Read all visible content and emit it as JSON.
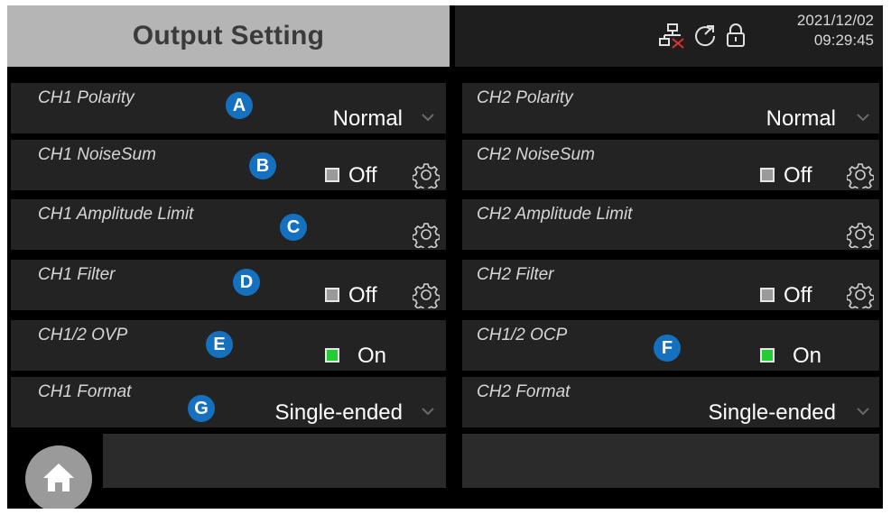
{
  "header": {
    "title": "Output Setting",
    "date": "2021/12/02",
    "time": "09:29:45"
  },
  "icons": {
    "network": "network-disconnected-icon",
    "refresh": "refresh-icon",
    "lock": "lock-icon",
    "home": "home-icon",
    "settings": "gear-icon",
    "dropdown": "chevron-down-icon"
  },
  "colors": {
    "badge": "#1670c0",
    "check_on": "#22cc33",
    "check_off": "#9a9a9a",
    "title_bar": "#b5b5b5"
  },
  "ch1": {
    "polarity": {
      "label": "CH1 Polarity",
      "value": "Normal",
      "badge": "A"
    },
    "noisesum": {
      "label": "CH1 NoiseSum",
      "state": "Off",
      "badge": "B"
    },
    "amplitude_limit": {
      "label": "CH1 Amplitude Limit",
      "badge": "C"
    },
    "filter": {
      "label": "CH1 Filter",
      "state": "Off",
      "badge": "D"
    },
    "ovp": {
      "label": "CH1/2 OVP",
      "state": "On",
      "badge": "E"
    },
    "format": {
      "label": "CH1 Format",
      "value": "Single-ended",
      "badge": "G"
    }
  },
  "ch2": {
    "polarity": {
      "label": "CH2 Polarity",
      "value": "Normal"
    },
    "noisesum": {
      "label": "CH2 NoiseSum",
      "state": "Off"
    },
    "amplitude_limit": {
      "label": "CH2 Amplitude Limit"
    },
    "filter": {
      "label": "CH2 Filter",
      "state": "Off"
    },
    "ocp": {
      "label": "CH1/2 OCP",
      "state": "On",
      "badge": "F"
    },
    "format": {
      "label": "CH2 Format",
      "value": "Single-ended"
    }
  }
}
